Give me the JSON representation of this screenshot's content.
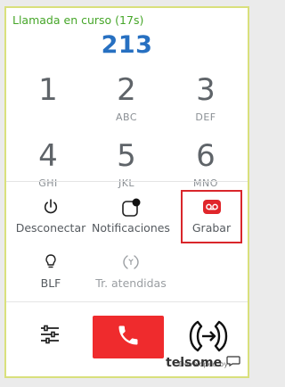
{
  "call": {
    "status": "Llamada en curso (17s)",
    "number": "213"
  },
  "keypad": [
    {
      "digit": "1",
      "letters": ""
    },
    {
      "digit": "2",
      "letters": "ABC"
    },
    {
      "digit": "3",
      "letters": "DEF"
    },
    {
      "digit": "4",
      "letters": "GHI"
    },
    {
      "digit": "5",
      "letters": "JKL"
    },
    {
      "digit": "6",
      "letters": "MNO"
    }
  ],
  "actions": {
    "disconnect": "Desconectar",
    "notifications": "Notificaciones",
    "record": "Grabar",
    "blf": "BLF",
    "attended": "Tr. atendidas"
  },
  "footer": {
    "developed_by": "Developed by",
    "brand": "telsome"
  },
  "colors": {
    "status": "#46a629",
    "number": "#2770c1",
    "hangup": "#ef2b2d",
    "record_icon": "#e0262b",
    "panel_border": "#d9e07c"
  },
  "icons": {
    "disconnect": "power-icon",
    "notifications": "notification-dot-icon",
    "record": "voicemail-icon",
    "blf": "lightbulb-icon",
    "attended": "phone-ringing-icon",
    "settings": "sliders-icon",
    "hangup": "phone-icon",
    "transfer": "call-transfer-icon"
  }
}
